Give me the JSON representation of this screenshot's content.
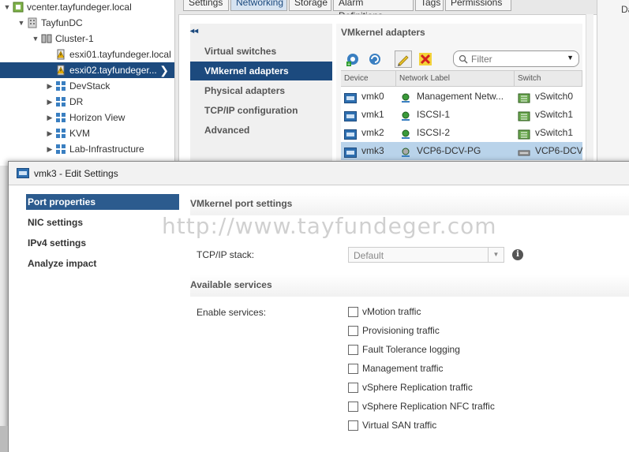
{
  "tree": {
    "items": [
      {
        "label": "vcenter.tayfundeger.local",
        "icon": "vcenter-icon",
        "toggle": "▼",
        "depth": 0
      },
      {
        "label": "TayfunDC",
        "icon": "datacenter-icon",
        "toggle": "▼",
        "depth": 1
      },
      {
        "label": "Cluster-1",
        "icon": "cluster-icon",
        "toggle": "▼",
        "depth": 2
      },
      {
        "label": "esxi01.tayfundeger.local",
        "icon": "host-warning-icon",
        "toggle": "",
        "depth": 3
      },
      {
        "label": "esxi02.tayfundeger...",
        "icon": "host-warning-icon",
        "toggle": "",
        "depth": 3,
        "selected": true
      },
      {
        "label": "DevStack",
        "icon": "vapp-icon",
        "toggle": "▶",
        "depth": 3
      },
      {
        "label": "DR",
        "icon": "vapp-icon",
        "toggle": "▶",
        "depth": 3
      },
      {
        "label": "Horizon View",
        "icon": "vapp-icon",
        "toggle": "▶",
        "depth": 3
      },
      {
        "label": "KVM",
        "icon": "vapp-icon",
        "toggle": "▶",
        "depth": 3
      },
      {
        "label": "Lab-Infrastructure",
        "icon": "vapp-icon",
        "toggle": "▶",
        "depth": 3
      }
    ],
    "selected_chevron": "❯"
  },
  "tabs": [
    "Settings",
    "Networking",
    "Storage",
    "Alarm Definitions",
    "Tags",
    "Permissions"
  ],
  "active_tab": "Networking",
  "right_column_label": "Da",
  "networking_nav": {
    "collapse_glyph": "◂◂",
    "items": [
      "Virtual switches",
      "VMkernel adapters",
      "Physical adapters",
      "TCP/IP configuration",
      "Advanced"
    ],
    "selected": "VMkernel adapters"
  },
  "vmkernel": {
    "title": "VMkernel adapters",
    "toolbar": [
      "add-networking-icon",
      "refresh-icon",
      "edit-settings-icon",
      "remove-icon"
    ],
    "filter_placeholder": "Filter",
    "columns": [
      "Device",
      "Network Label",
      "Switch"
    ],
    "rows": [
      {
        "device": "vmk0",
        "label": "Management Netw...",
        "switch": "vSwitch0",
        "selected": false
      },
      {
        "device": "vmk1",
        "label": "ISCSI-1",
        "switch": "vSwitch1",
        "selected": false
      },
      {
        "device": "vmk2",
        "label": "ISCSI-2",
        "switch": "vSwitch1",
        "selected": false
      },
      {
        "device": "vmk3",
        "label": "VCP6-DCV-PG",
        "switch": "VCP6-DCV",
        "selected": true
      }
    ]
  },
  "dialog": {
    "title": "vmk3 - Edit Settings",
    "side_items": [
      "Port properties",
      "NIC settings",
      "IPv4 settings",
      "Analyze impact"
    ],
    "selected_side_item": "Port properties",
    "section_port": "VMkernel port settings",
    "tcpip_label": "TCP/IP stack:",
    "tcpip_value": "Default",
    "section_services": "Available services",
    "enable_label": "Enable services:",
    "services": [
      {
        "label": "vMotion traffic",
        "checked": false
      },
      {
        "label": "Provisioning traffic",
        "checked": false
      },
      {
        "label": "Fault Tolerance logging",
        "checked": false
      },
      {
        "label": "Management traffic",
        "checked": false
      },
      {
        "label": "vSphere Replication traffic",
        "checked": false
      },
      {
        "label": "vSphere Replication NFC traffic",
        "checked": false
      },
      {
        "label": "Virtual SAN traffic",
        "checked": false
      }
    ]
  },
  "watermark": "http://www.tayfundeger.com"
}
